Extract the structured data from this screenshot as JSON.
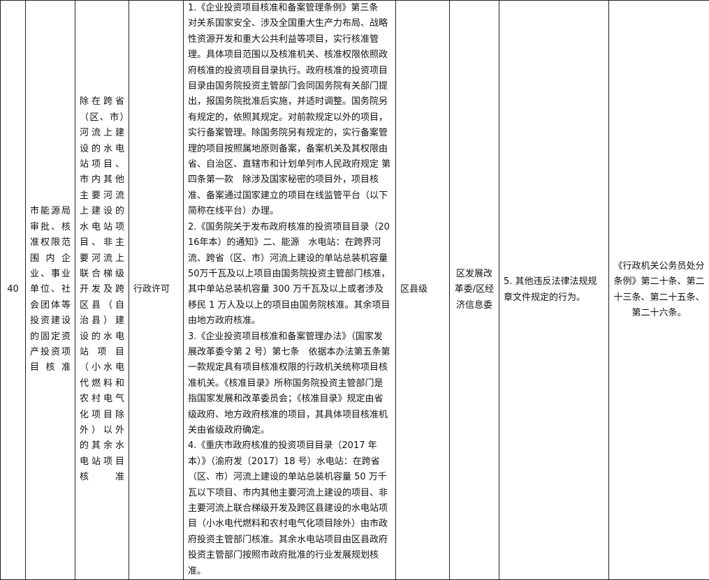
{
  "row": {
    "number": "40",
    "item_name": "市能源局审批、核准权限范围内企业、事业单位、社会团体等投资建设的固定资产投资项目核准",
    "sub_item": "除在跨省（区、市）河流上建设的水电站项目、市内其他主要河流上建设的水电站项目、非主要河流上联合梯级开发及跨区县（自治县）建设的水电站项目（小水电代燃料和农村电气化项目除外）以外的其余水电站项目核准",
    "basis": [
      "1.《企业投资项目核准和备案管理条例》第三条　对关系国家安全、涉及全国重大生产力布局、战略性资源开发和重大公共利益等项目，实行核准管理。具体项目范围以及核准机关、核准权限依照政府核准的投资项目目录执行。政府核准的投资项目目录由国务院投资主管部门会同国务院有关部门提出，报国务院批准后实施，并适时调整。国务院另有规定的，依照其规定。对前款规定以外的项目，实行备案管理。除国务院另有规定的，实行备案管理的项目按照属地原则备案，备案机关及其权限由省、自治区、直辖市和计划单列市人民政府规定 第四条第一款　除涉及国家秘密的项目外，项目核准、备案通过国家建立的项目在线监管平台（以下简称在线平台）办理。",
      "2.《国务院关于发布政府核准的投资项目目录（2016年本）的通知》二、能源　水电站：在跨界河流、跨省（区、市）河流上建设的单站总装机容量50万千瓦及以上项目由国务院投资主管部门核准，其中单站总装机容量 300 万千瓦及以上或者涉及移民 1 万人及以上的项目由国务院核准。其余项目由地方政府核准。",
      "3.《企业投资项目核准和备案管理办法》（国家发展改革委令第 2 号）第七条　依据本办法第五条第一款规定具有项目核准权限的行政机关统称项目核准机关。《核准目录》所称国务院投资主管部门是指国家发展和改革委员会；《核准目录》规定由省级政府、地方政府核准的项目，其具体项目核准机关由省级政府确定。",
      "4.《重庆市政府核准的投资项目目录（2017 年本）》（渝府发〔2017〕18 号）水电站：在跨省（区、市）河流上建设的单站总装机容量 50 万千瓦以下项目、市内其他主要河流上建设的项目、非主要河流上联合梯级开发及跨区县建设的水电站项目（小水电代燃料和农村电气化项目除外）由市政府投资主管部门核准。其余水电站项目由区县政府投资主管部门按照市政府批准的行业发展规划核准。"
    ],
    "power_type": "行政许可",
    "level": "区县级",
    "department": "区发展改革委/区经济信息委",
    "condition": "5. 其他违反法律法规规章文件规定的行为。",
    "law": "《行政机关公务员处分条例》第二十条、第二十三条、第二十五条、第二十六条。"
  }
}
